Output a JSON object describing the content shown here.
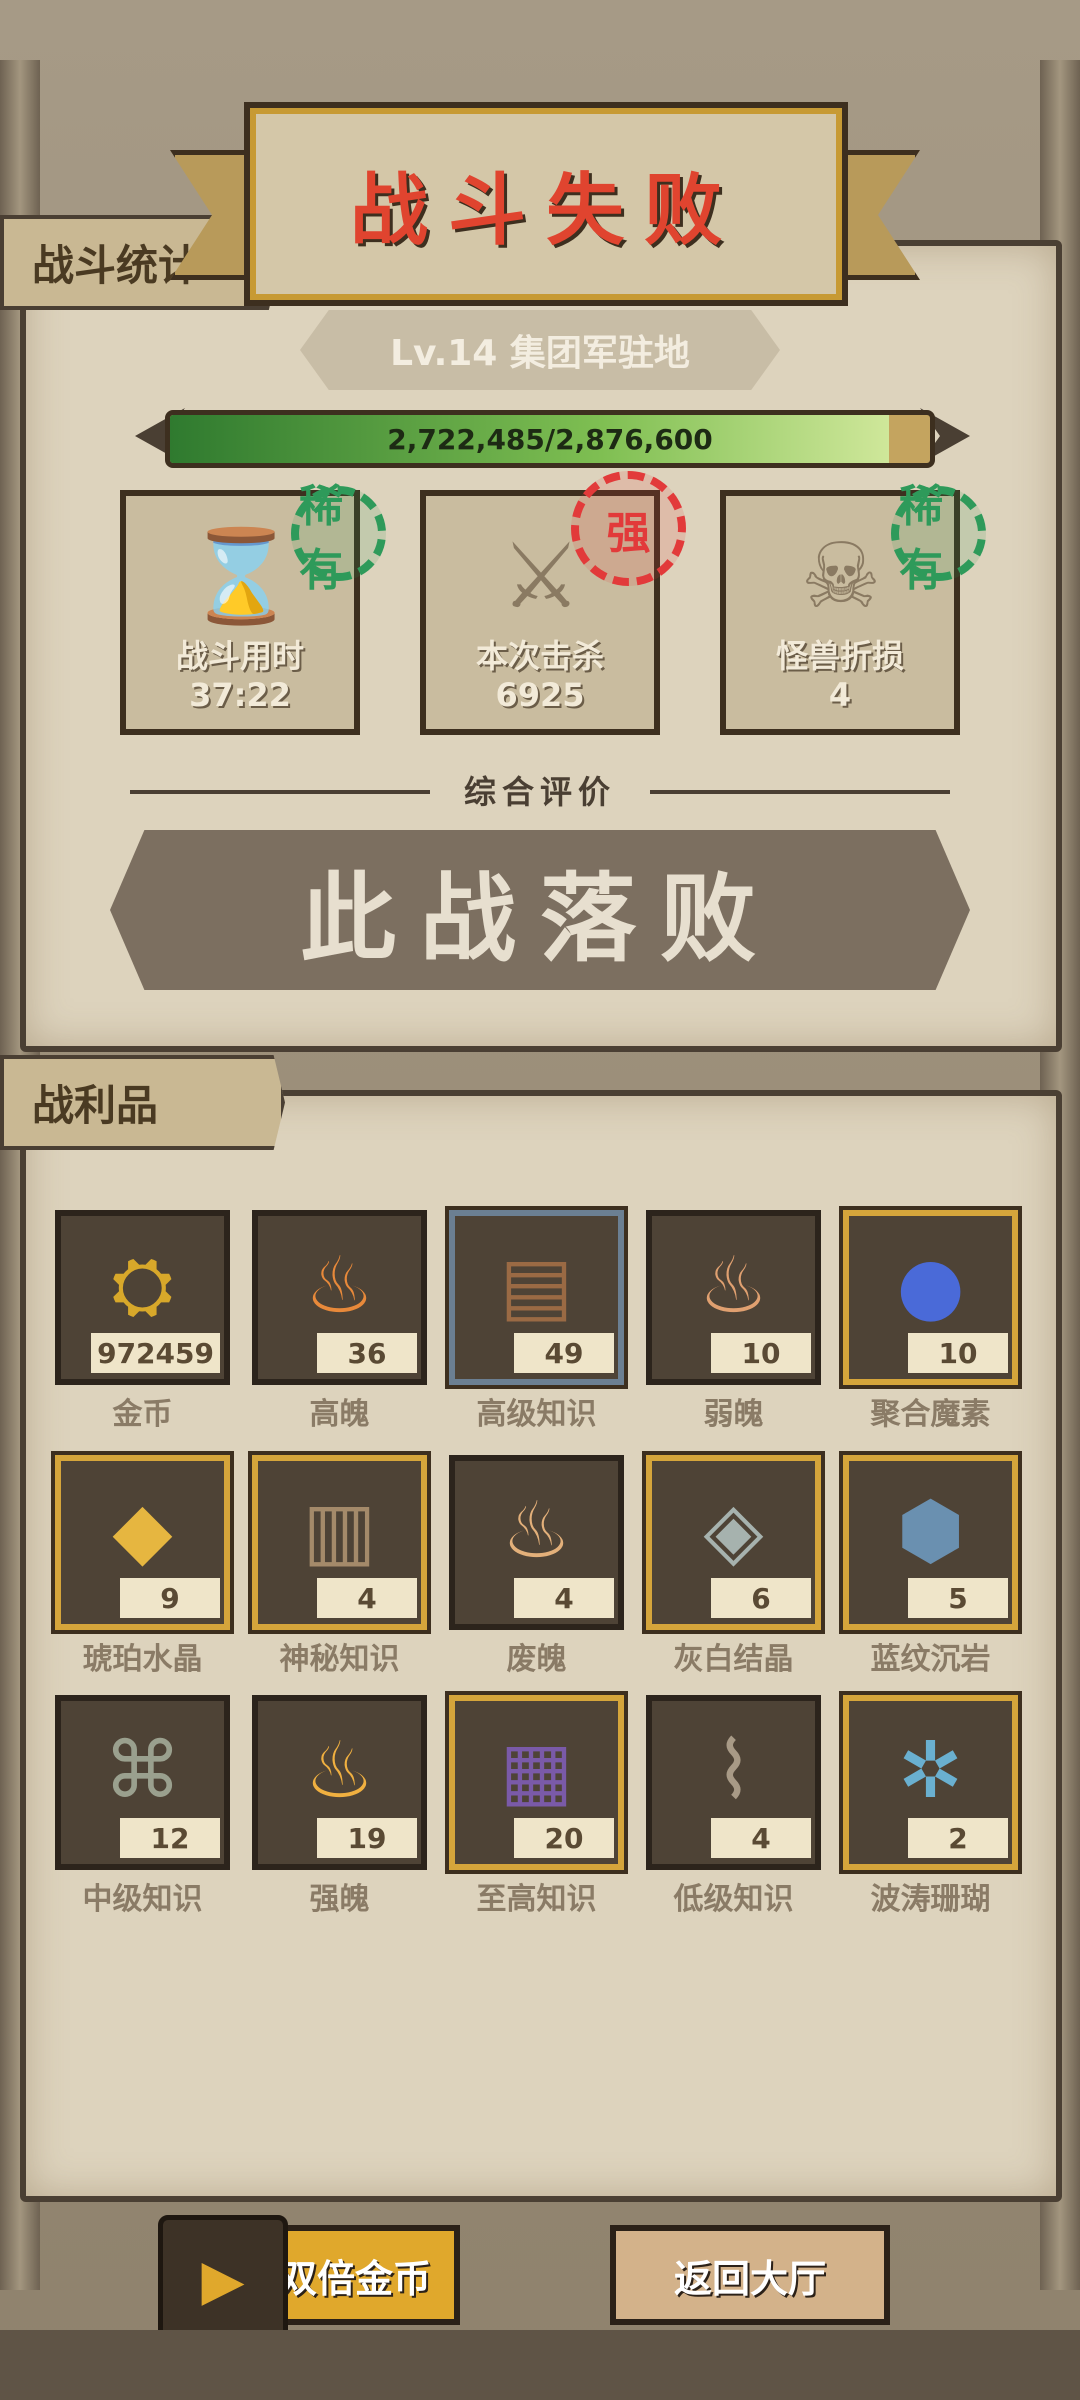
{
  "title": "战斗失败",
  "battle_stats": {
    "tab_label": "战斗统计",
    "level": "Lv.14 集团军驻地",
    "progress_text": "2,722,485/2,876,600",
    "progress_fraction": 0.946,
    "cards": [
      {
        "label": "战斗用时",
        "value": "37:22",
        "icon": "hourglass-icon",
        "stamp": "稀有",
        "stamp_color": "#2e9a5a"
      },
      {
        "label": "本次击杀",
        "value": "6925",
        "icon": "crossed-swords-icon",
        "stamp": "强",
        "stamp_color": "#e23a3a"
      },
      {
        "label": "怪兽折损",
        "value": "4",
        "icon": "monster-skull-icon",
        "stamp": "稀有",
        "stamp_color": "#2e9a5a"
      }
    ],
    "rating_label": "综合评价",
    "verdict": "此战落败"
  },
  "loot": {
    "tab_label": "战利品",
    "items": [
      {
        "name": "金币",
        "count": "972459",
        "frame": "plain",
        "icon_char": "⛭",
        "color": "#d8a82a"
      },
      {
        "name": "高魄",
        "count": "36",
        "frame": "plain",
        "icon_char": "♨",
        "color": "#e8893a"
      },
      {
        "name": "高级知识",
        "count": "49",
        "frame": "blue",
        "icon_char": "▤",
        "color": "#9a6a44"
      },
      {
        "name": "弱魄",
        "count": "10",
        "frame": "plain",
        "icon_char": "♨",
        "color": "#e0a070"
      },
      {
        "name": "聚合魔素",
        "count": "10",
        "frame": "gold",
        "icon_char": "●",
        "color": "#4a6ad8"
      },
      {
        "name": "琥珀水晶",
        "count": "9",
        "frame": "gold",
        "icon_char": "◆",
        "color": "#e6b640"
      },
      {
        "name": "神秘知识",
        "count": "4",
        "frame": "gold",
        "icon_char": "▥",
        "color": "#a48a6a"
      },
      {
        "name": "废魄",
        "count": "4",
        "frame": "plain",
        "icon_char": "♨",
        "color": "#e3b07a"
      },
      {
        "name": "灰白结晶",
        "count": "6",
        "frame": "gold",
        "icon_char": "◈",
        "color": "#a6b2ae"
      },
      {
        "name": "蓝纹沉岩",
        "count": "5",
        "frame": "gold",
        "icon_char": "⬢",
        "color": "#6a90b0"
      },
      {
        "name": "中级知识",
        "count": "12",
        "frame": "plain",
        "icon_char": "⌘",
        "color": "#9aa08e"
      },
      {
        "name": "强魄",
        "count": "19",
        "frame": "plain",
        "icon_char": "♨",
        "color": "#f0b040"
      },
      {
        "name": "至高知识",
        "count": "20",
        "frame": "gold",
        "icon_char": "▦",
        "color": "#7a5aa8"
      },
      {
        "name": "低级知识",
        "count": "4",
        "frame": "plain",
        "icon_char": "⌇",
        "color": "#a89a86"
      },
      {
        "name": "波涛珊瑚",
        "count": "2",
        "frame": "gold",
        "icon_char": "✲",
        "color": "#6ab0d0"
      }
    ]
  },
  "buttons": {
    "double_gold": "双倍金币",
    "return_lobby": "返回大厅"
  }
}
